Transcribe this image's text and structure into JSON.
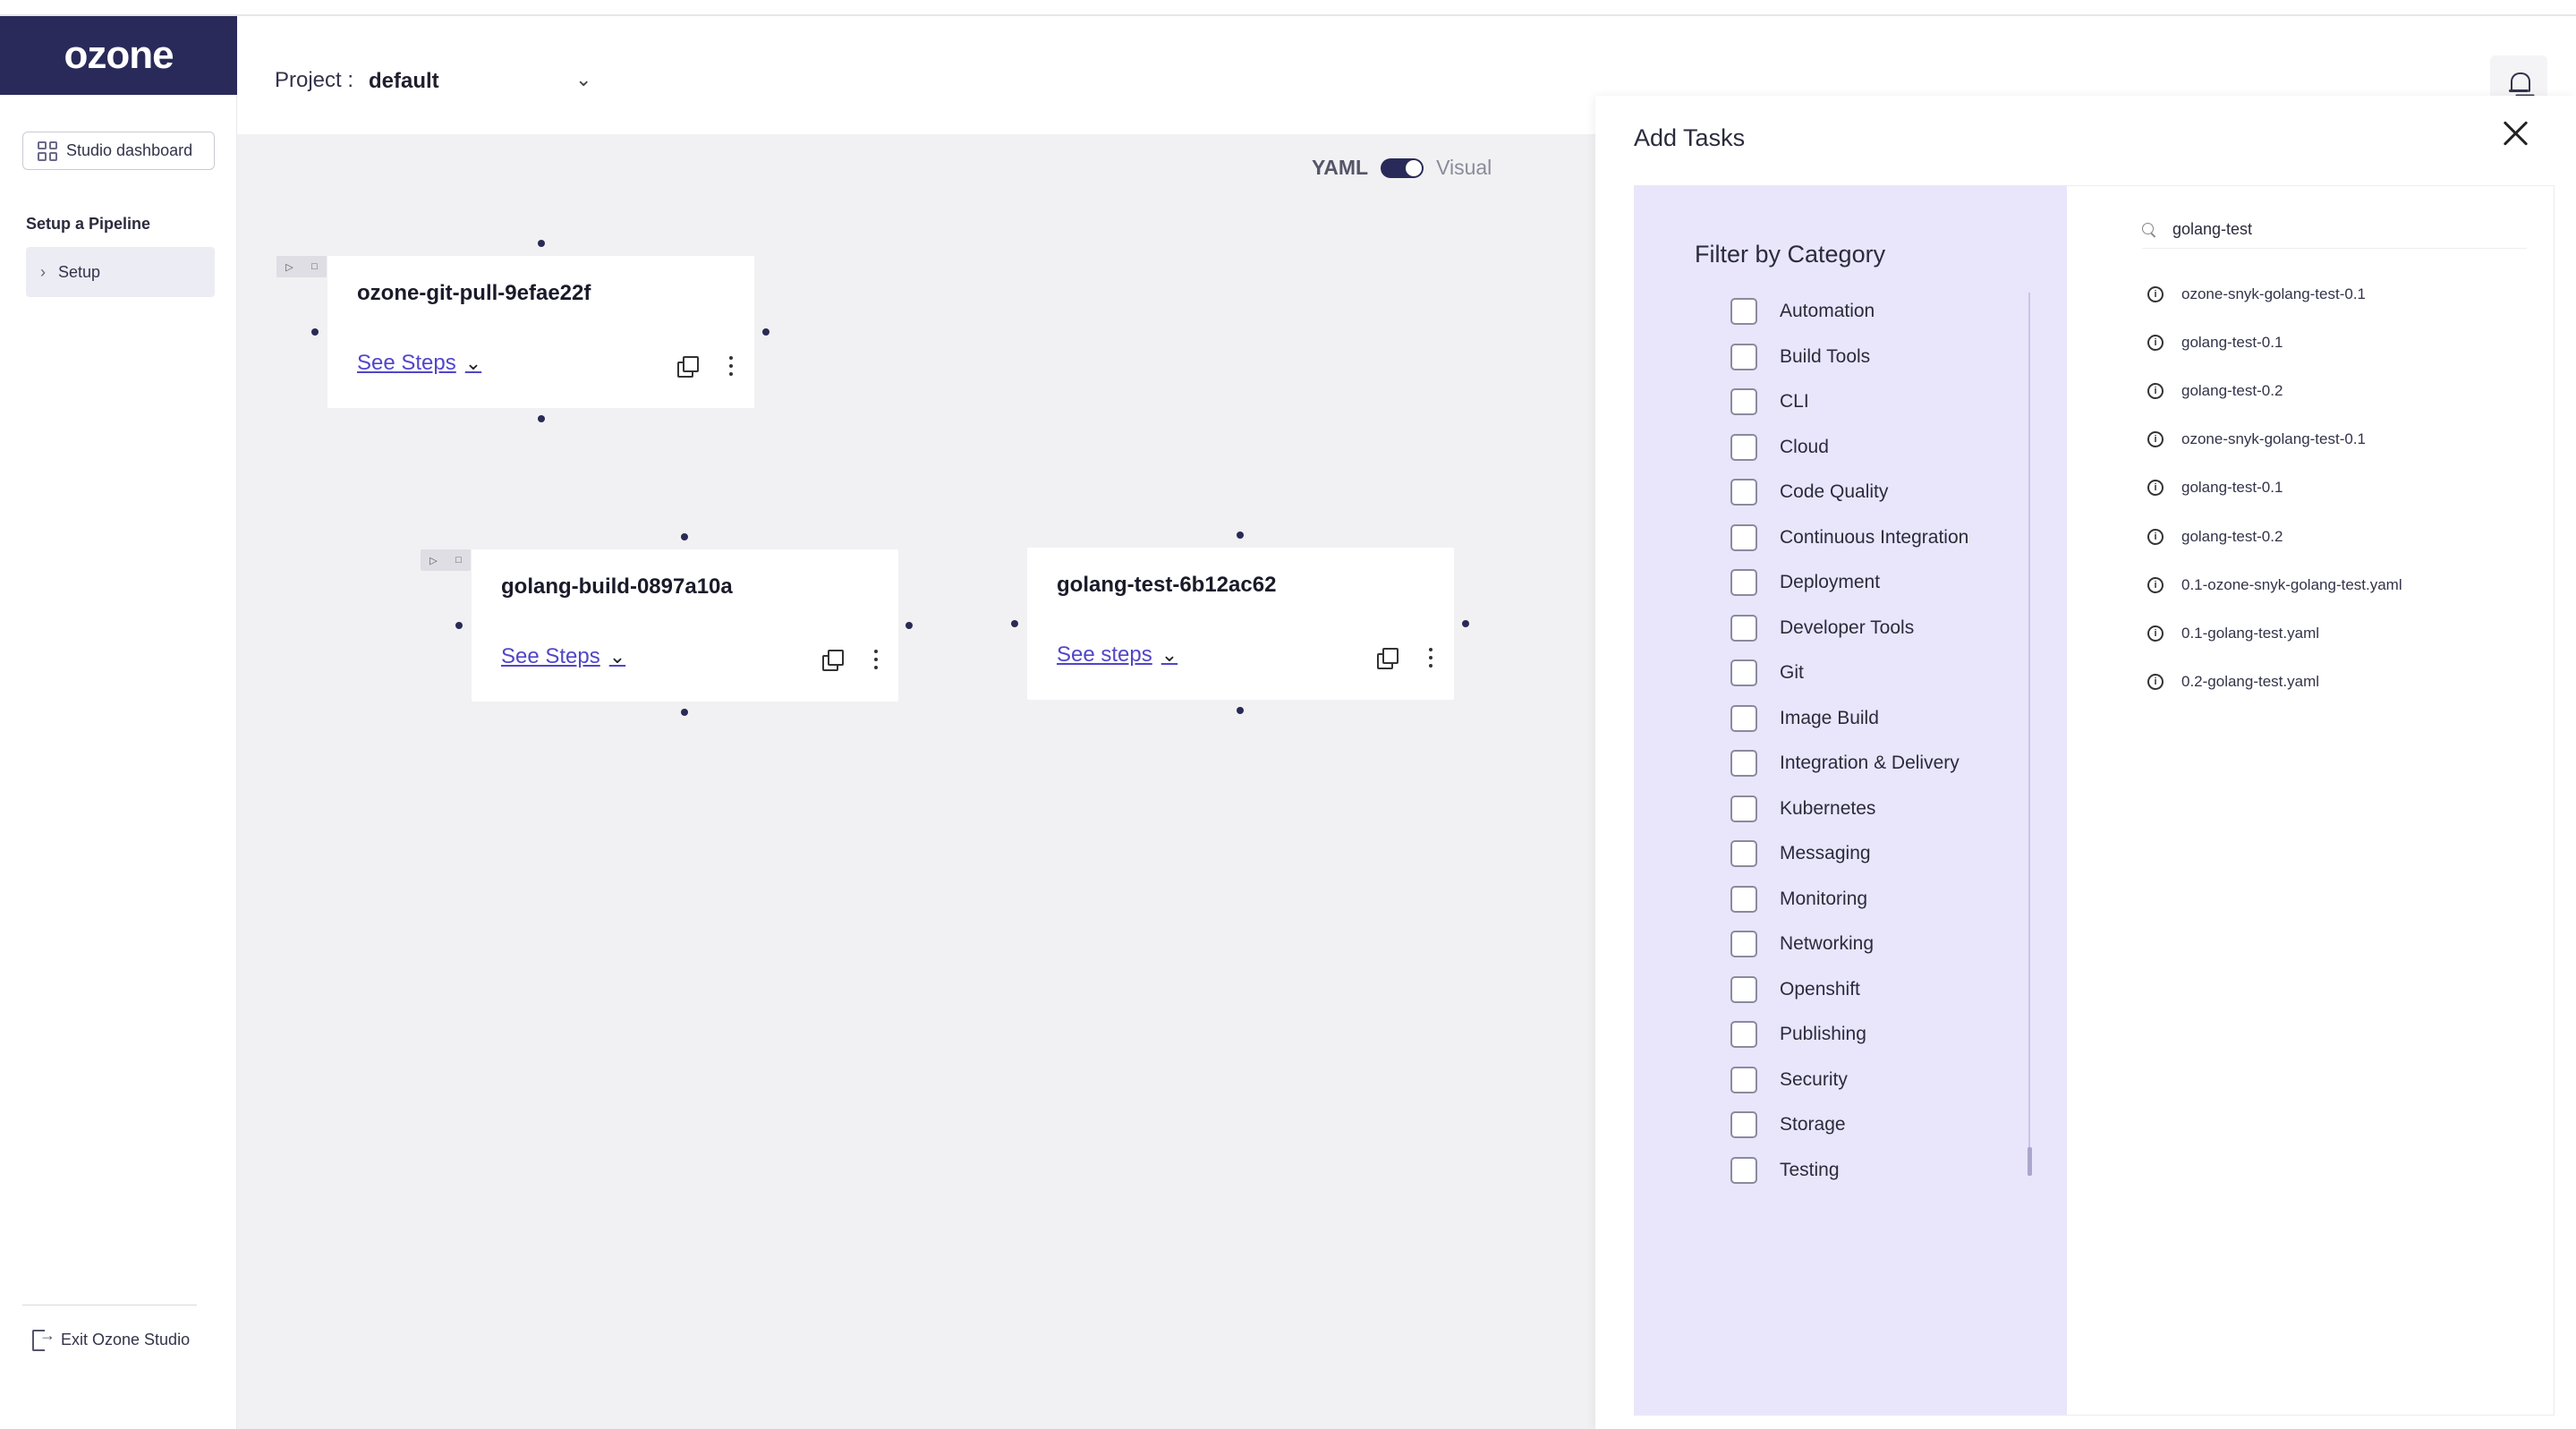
{
  "sidebar": {
    "logo": "ozone",
    "dashboard_button": "Studio dashboard",
    "section_title": "Setup a Pipeline",
    "items": [
      {
        "label": "Setup"
      }
    ],
    "exit_label": "Exit Ozone Studio"
  },
  "header": {
    "project_label": "Project :",
    "project_value": "default"
  },
  "canvas": {
    "toggle": {
      "left": "YAML",
      "right": "Visual",
      "state": "visual"
    },
    "nodes": [
      {
        "title": "ozone-git-pull-9efae22f",
        "steps_label": "See Steps"
      },
      {
        "title": "golang-build-0897a10a",
        "steps_label": "See Steps"
      },
      {
        "title": "golang-test-6b12ac62",
        "steps_label": "See steps"
      }
    ]
  },
  "panel": {
    "title": "Add Tasks",
    "filter_title": "Filter by Category",
    "categories": [
      {
        "label": "Automation"
      },
      {
        "label": "Build Tools"
      },
      {
        "label": "CLI"
      },
      {
        "label": "Cloud"
      },
      {
        "label": "Code Quality"
      },
      {
        "label": "Continuous Integration"
      },
      {
        "label": "Deployment"
      },
      {
        "label": "Developer Tools"
      },
      {
        "label": "Git"
      },
      {
        "label": "Image Build"
      },
      {
        "label": "Integration & Delivery"
      },
      {
        "label": "Kubernetes"
      },
      {
        "label": "Messaging"
      },
      {
        "label": "Monitoring"
      },
      {
        "label": "Networking"
      },
      {
        "label": "Openshift"
      },
      {
        "label": "Publishing"
      },
      {
        "label": "Security"
      },
      {
        "label": "Storage"
      },
      {
        "label": "Testing"
      }
    ],
    "search_value": "golang-test",
    "results": [
      {
        "label": "ozone-snyk-golang-test-0.1"
      },
      {
        "label": "golang-test-0.1"
      },
      {
        "label": "golang-test-0.2"
      },
      {
        "label": "ozone-snyk-golang-test-0.1"
      },
      {
        "label": "golang-test-0.1"
      },
      {
        "label": "golang-test-0.2"
      },
      {
        "label": "0.1-ozone-snyk-golang-test.yaml"
      },
      {
        "label": "0.1-golang-test.yaml"
      },
      {
        "label": "0.2-golang-test.yaml"
      }
    ]
  },
  "colors": {
    "brand": "#2a2a5a",
    "link": "#5146c9",
    "filter_bg": "#e9e6fb",
    "canvas_bg": "#f1f1f3"
  }
}
